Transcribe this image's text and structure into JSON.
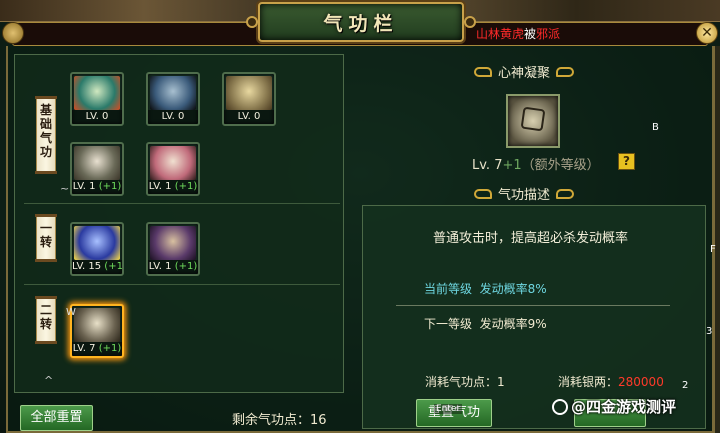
{
  "window": {
    "title": "气功栏"
  },
  "notice": {
    "part1": "山林黄虎",
    "part2": "被",
    "part3": "邪派"
  },
  "categories": [
    {
      "label": "基础气功"
    },
    {
      "label": "一转"
    },
    {
      "label": "二转"
    }
  ],
  "skills": [
    {
      "level": "LV. 0",
      "bonus": "",
      "art_colors": [
        "#2a7a6a",
        "#d0e8c0",
        "#d84a20"
      ],
      "icon": "orange-fruit-icon"
    },
    {
      "level": "LV. 0",
      "bonus": "",
      "art_colors": [
        "#3a5a7a",
        "#a8c0d0",
        "#0a0a0a"
      ],
      "icon": "crossed-blades-icon"
    },
    {
      "level": "LV. 0",
      "bonus": "",
      "art_colors": [
        "#8a7a50",
        "#e8d8a0",
        "#4a3a20"
      ],
      "icon": "golden-hand-icon"
    },
    {
      "level": "LV. 1",
      "bonus": "(+1)",
      "art_colors": [
        "#6a6a58",
        "#e8e0d0",
        "#3a3428"
      ],
      "icon": "white-hair-icon"
    },
    {
      "level": "LV. 1",
      "bonus": "(+1)",
      "art_colors": [
        "#c06a7a",
        "#f0e0d0",
        "#2a1a18"
      ],
      "icon": "warrior-portrait-icon"
    },
    {
      "level": "LV. 15",
      "bonus": "(+1)",
      "art_colors": [
        "#2a3aa0",
        "#a8c0ff",
        "#ffe040"
      ],
      "icon": "lightning-orb-icon"
    },
    {
      "level": "LV. 1",
      "bonus": "(+1)",
      "art_colors": [
        "#5a3a6a",
        "#d8c0a0",
        "#1a1020"
      ],
      "icon": "claw-grip-icon"
    },
    {
      "level": "LV. 7",
      "bonus": "(+1)",
      "art_colors": [
        "#6a6250",
        "#e8e0c8",
        "#2a2418"
      ],
      "icon": "spirit-seal-icon"
    }
  ],
  "remaining_points": {
    "label": "剩余气功点：16"
  },
  "reset_all_button": "全部重置",
  "detail": {
    "skill_name": "心神凝聚",
    "level_main": "Lv. 7",
    "level_plus": "+1",
    "level_extra": "（额外等级）",
    "help": "?",
    "desc_title": "气功描述",
    "description": "普通攻击时，提高超必杀发动概率",
    "current_label": "当前等级",
    "current_value": "发动概率8%",
    "next_label": "下一等级",
    "next_value": "发动概率9%",
    "cost_points": "消耗气功点：1",
    "cost_silver_label": "消耗银两：",
    "cost_silver_value": "280000",
    "reset_button": "重置气功",
    "enter_tag": "Enter"
  },
  "watermark": "@四金游戏测评",
  "stray_chars": {
    "b": "B",
    "f": "F",
    "three": "3",
    "two": "2",
    "w": "W"
  },
  "colors": {
    "gold_border": "#c8a14a",
    "panel_green": "#173325",
    "accent_red": "#ff3a2a",
    "bonus_green": "#6fdc5c",
    "cyan": "#6ed6e0"
  }
}
